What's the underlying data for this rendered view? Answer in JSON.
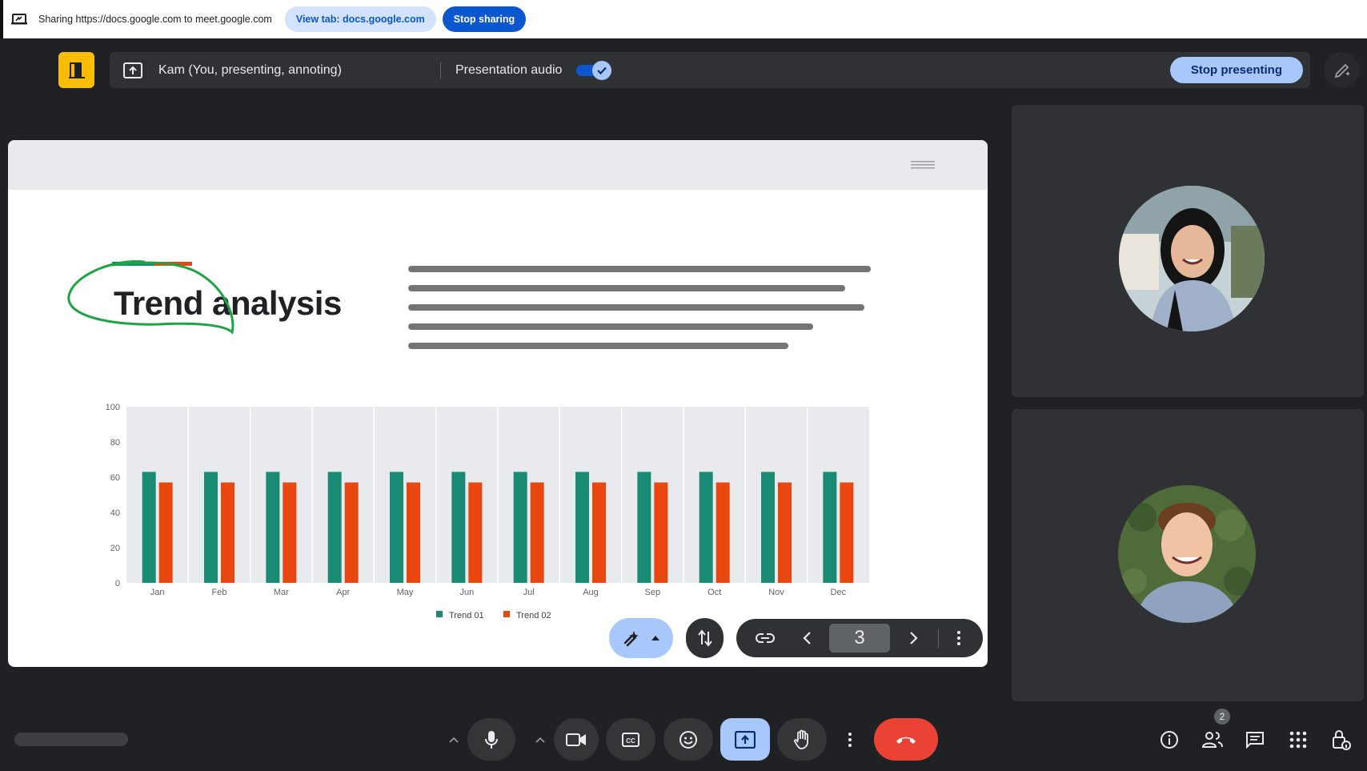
{
  "share_bar": {
    "text": "Sharing https://docs.google.com to meet.google.com",
    "view_tab_label": "View tab: docs.google.com",
    "stop_sharing_label": "Stop sharing"
  },
  "present_bar": {
    "presenter_text": "Kam (You, presenting, annoting)",
    "audio_label": "Presentation audio",
    "audio_enabled": true,
    "stop_presenting_label": "Stop presenting"
  },
  "slide": {
    "title": "Trend analysis",
    "page_number": "3"
  },
  "chart_data": {
    "type": "bar",
    "categories": [
      "Jan",
      "Feb",
      "Mar",
      "Apr",
      "May",
      "Jun",
      "Jul",
      "Aug",
      "Sep",
      "Oct",
      "Nov",
      "Dec"
    ],
    "series": [
      {
        "name": "Trend 01",
        "color": "#1a8a73",
        "values": [
          63,
          63,
          63,
          63,
          63,
          63,
          63,
          63,
          63,
          63,
          63,
          63
        ]
      },
      {
        "name": "Trend 02",
        "color": "#e8470f",
        "values": [
          57,
          57,
          57,
          57,
          57,
          57,
          57,
          57,
          57,
          57,
          57,
          57
        ]
      }
    ],
    "yticks": [
      "0",
      "20",
      "40",
      "60",
      "80",
      "100"
    ],
    "ylim": [
      0,
      100
    ],
    "grid": true,
    "legend": "bottom-center"
  },
  "bottom_bar": {
    "participant_count": "2"
  },
  "colors": {
    "background": "#202124",
    "accent": "#0b57d0",
    "accent_light": "#a8c7fa",
    "end_call": "#ea4335",
    "logo": "#fbbc04"
  },
  "icons": {
    "share": "cast-icon",
    "present": "present-to-all-icon",
    "annotate": "pen-sparkle-icon",
    "laser": "laser-pointer-icon",
    "swap": "swap-vertical-icon",
    "link": "link-icon",
    "prev": "chevron-left-icon",
    "next": "chevron-right-icon",
    "more": "more-vert-icon"
  }
}
